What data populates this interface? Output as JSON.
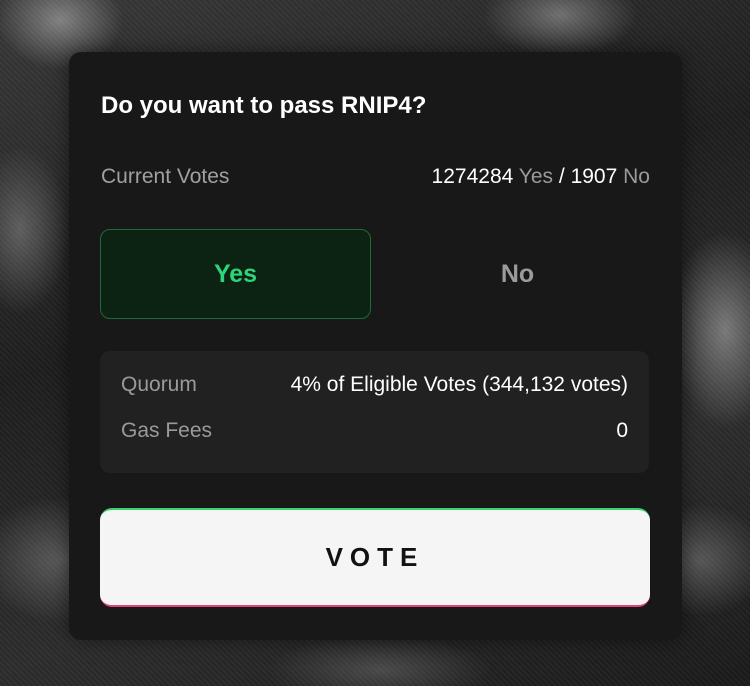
{
  "proposal": {
    "question": "Do you want to pass RNIP4?"
  },
  "current_votes": {
    "label": "Current Votes",
    "yes_count": "1274284",
    "yes_label": "Yes",
    "separator": "/",
    "no_count": "1907",
    "no_label": "No"
  },
  "options": {
    "yes_label": "Yes",
    "no_label": "No",
    "selected": "Yes"
  },
  "details": {
    "quorum_label": "Quorum",
    "quorum_value": "4% of Eligible Votes (344,132 votes)",
    "gas_label": "Gas Fees",
    "gas_value": "0"
  },
  "vote_button": {
    "label": "VOTE"
  },
  "colors": {
    "accent_green": "#2ed47a",
    "selected_bg": "#0c2212",
    "card_bg": "#181818",
    "button_bg": "#f5f5f5"
  }
}
